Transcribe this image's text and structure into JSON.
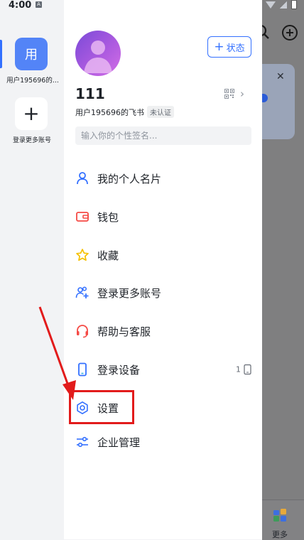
{
  "status_bar": {
    "time": "4:00",
    "notification_letter": "A"
  },
  "rail": {
    "active_account_initial": "用",
    "active_account_name": "用户195696的...",
    "add_account_symbol": "+",
    "add_account_label": "登录更多账号"
  },
  "profile": {
    "status_button_label": "状态",
    "name": "111",
    "subtitle": "用户195696的飞书",
    "verification_badge": "未认证",
    "signature_placeholder": "输入你的个性签名..."
  },
  "menu": [
    {
      "label": "我的个人名片",
      "icon": "person-icon"
    },
    {
      "label": "钱包",
      "icon": "wallet-icon"
    },
    {
      "label": "收藏",
      "icon": "star-icon"
    },
    {
      "label": "登录更多账号",
      "icon": "add-accounts-icon"
    },
    {
      "label": "帮助与客服",
      "icon": "headset-icon"
    },
    {
      "label": "登录设备",
      "icon": "phone-icon",
      "count": "1"
    },
    {
      "label": "设置",
      "icon": "gear-icon"
    },
    {
      "label": "企业管理",
      "icon": "sliders-icon"
    }
  ],
  "background_app": {
    "more_label": "更多"
  },
  "colors": {
    "accent": "#3370ff",
    "annotation": "#e21b1b"
  }
}
